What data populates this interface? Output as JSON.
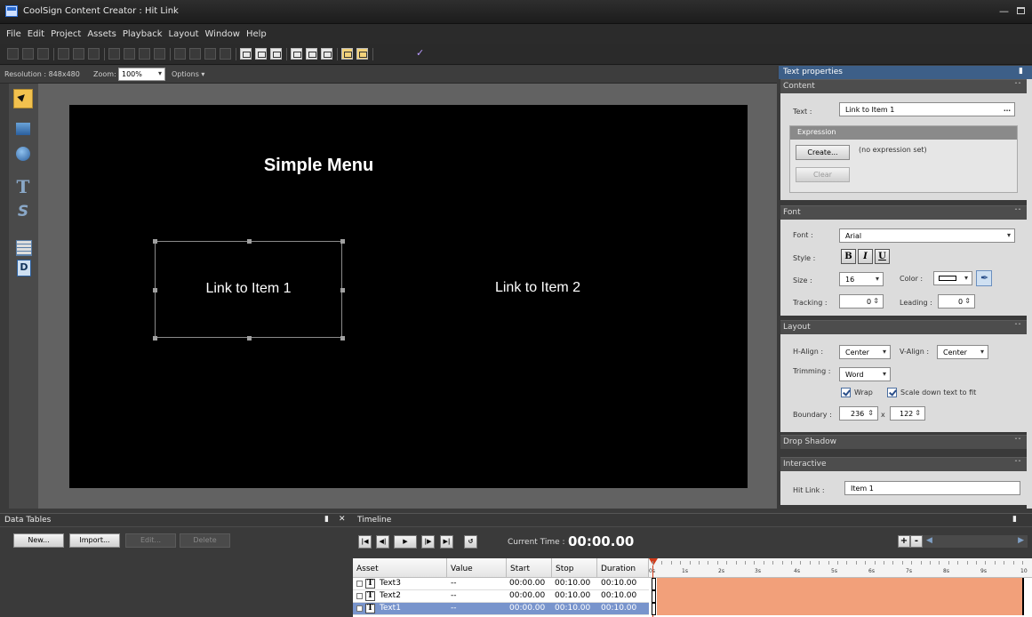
{
  "window": {
    "title": "CoolSign Content Creator : Hit Link"
  },
  "menu": [
    "File",
    "Edit",
    "Project",
    "Assets",
    "Playback",
    "Layout",
    "Window",
    "Help"
  ],
  "editor": {
    "resolution": "Resolution : 848x480",
    "zoom_label": "Zoom:",
    "zoom_value": "100%",
    "options_label": "Options ▾",
    "canvas": {
      "title": "Simple Menu",
      "link1": "Link to Item 1",
      "link2": "Link to Item 2"
    }
  },
  "tools": [
    "select-tool",
    "rectangle-tool",
    "ellipse-tool",
    "text-tool",
    "scrolling-text-tool",
    "data-table-tool",
    "dynamic-content-tool"
  ],
  "props": {
    "panel_title": "Text properties",
    "content": {
      "header": "Content",
      "text_label": "Text :",
      "text_value": "Link to Item 1",
      "more": "…",
      "expression_header": "Expression",
      "create_label": "Create...",
      "expression_status": "(no expression set)",
      "clear_label": "Clear"
    },
    "font": {
      "header": "Font",
      "font_label": "Font :",
      "font_value": "Arial",
      "style_label": "Style :",
      "bold": "B",
      "italic": "I",
      "underline": "U",
      "size_label": "Size :",
      "size_value": "16",
      "color_label": "Color :",
      "tracking_label": "Tracking :",
      "tracking_value": "0",
      "leading_label": "Leading :",
      "leading_value": "0"
    },
    "layout": {
      "header": "Layout",
      "halign_label": "H-Align :",
      "halign_value": "Center",
      "valign_label": "V-Align :",
      "valign_value": "Center",
      "trimming_label": "Trimming :",
      "trimming_value": "Word",
      "wrap_label": "Wrap",
      "scale_label": "Scale down text to fit",
      "boundary_label": "Boundary :",
      "boundary_w": "236",
      "boundary_x": "x",
      "boundary_h": "122"
    },
    "drop_shadow": {
      "header": "Drop Shadow"
    },
    "interactive": {
      "header": "Interactive",
      "hitlink_label": "Hit Link :",
      "hitlink_value": "Item 1"
    }
  },
  "datatables": {
    "title": "Data Tables",
    "buttons": [
      "New...",
      "Import...",
      "Edit...",
      "Delete"
    ]
  },
  "timeline": {
    "title": "Timeline",
    "current_time_label": "Current Time :",
    "current_time_value": "00:00.00",
    "columns": [
      "Asset",
      "Value",
      "Start",
      "Stop",
      "Duration"
    ],
    "rows": [
      {
        "asset": "Text3",
        "value": "--",
        "start": "00:00.00",
        "stop": "00:10.00",
        "duration": "00:10.00"
      },
      {
        "asset": "Text2",
        "value": "--",
        "start": "00:00.00",
        "stop": "00:10.00",
        "duration": "00:10.00"
      },
      {
        "asset": "Text1",
        "value": "--",
        "start": "00:00.00",
        "stop": "00:10.00",
        "duration": "00:10.00"
      }
    ],
    "ruler": [
      "0s",
      "1s",
      "2s",
      "3s",
      "4s",
      "5s",
      "6s",
      "7s",
      "8s",
      "9s",
      "10"
    ]
  }
}
